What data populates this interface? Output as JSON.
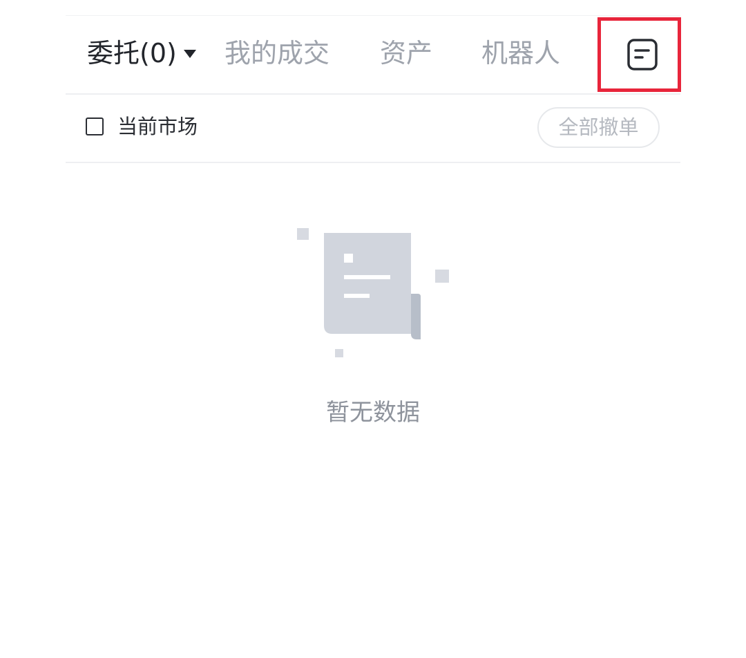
{
  "tabs": {
    "orders_label": "委托(0)",
    "trades_label": "我的成交",
    "assets_label": "资产",
    "robot_label": "机器人"
  },
  "filter": {
    "current_market_label": "当前市场",
    "current_market_checked": false,
    "cancel_all_label": "全部撤单"
  },
  "empty_state": {
    "message": "暂无数据",
    "icon": "empty-document-icon"
  },
  "toolbar": {
    "orders_icon": "order-list-icon"
  },
  "colors": {
    "active_tab": "#22252b",
    "inactive_tab": "#9ea3ac",
    "highlight": "#e8253b",
    "illustration": "#d1d5dd"
  }
}
